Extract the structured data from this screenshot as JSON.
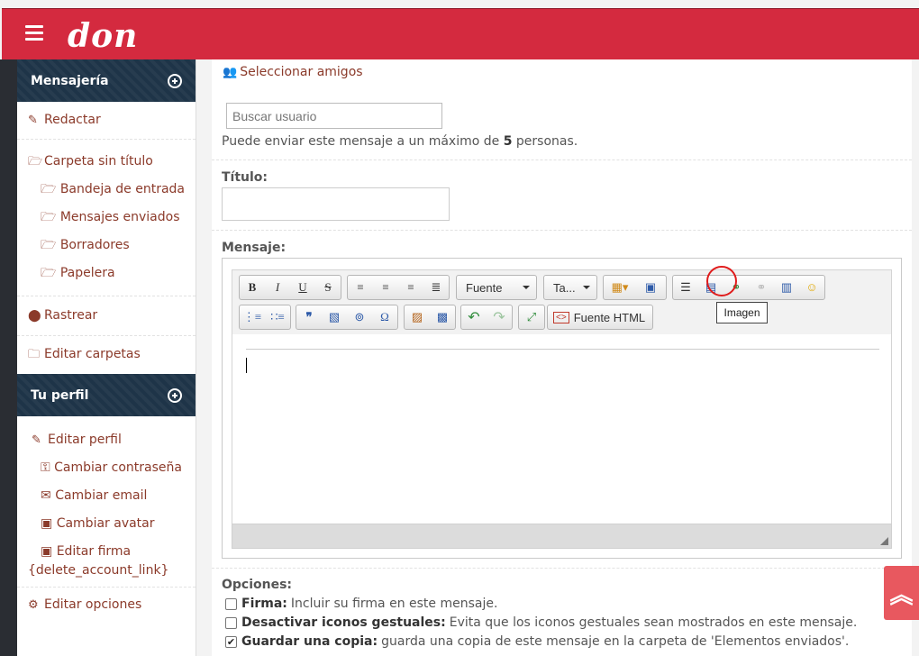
{
  "header": {
    "brand": "don",
    "menu_icon": "hamburger-icon"
  },
  "sidebar": {
    "messaging": {
      "title": "Mensajería",
      "items": {
        "compose": "Redactar",
        "folder_untitled": "Carpeta sin título",
        "inbox": "Bandeja de entrada",
        "sent": "Mensajes enviados",
        "drafts": "Borradores",
        "trash": "Papelera",
        "track": "Rastrear",
        "edit_folders": "Editar carpetas"
      }
    },
    "profile": {
      "title": "Tu perfil",
      "items": {
        "edit_profile": "Editar perfil",
        "change_password": "Cambiar contraseña",
        "change_email": "Cambiar email",
        "change_avatar": "Cambiar avatar",
        "edit_signature": "Editar firma",
        "delete_account": "{delete_account_link}",
        "edit_options": "Editar opciones"
      }
    }
  },
  "main": {
    "select_friends": "Seleccionar amigos",
    "search_placeholder": "Buscar usuario",
    "hint_pre": "Puede enviar este mensaje a un máximo de ",
    "hint_count": "5",
    "hint_post": " personas.",
    "title_label": "Título:",
    "message_label": "Mensaje:",
    "editor": {
      "font_combo": "Fuente",
      "size_combo": "Ta...",
      "source_button": "Fuente HTML",
      "tooltip": "Imagen"
    },
    "options": {
      "label": "Opciones:",
      "signature_bold": "Firma:",
      "signature_text": "Incluir su firma en este mensaje.",
      "smilies_bold": "Desactivar iconos gestuales:",
      "smilies_text": "Evita que los iconos gestuales sean mostrados en este mensaje.",
      "savecopy_bold": "Guardar una copia:",
      "savecopy_text": "guarda una copia de este mensaje en la carpeta de 'Elementos enviados'."
    }
  }
}
